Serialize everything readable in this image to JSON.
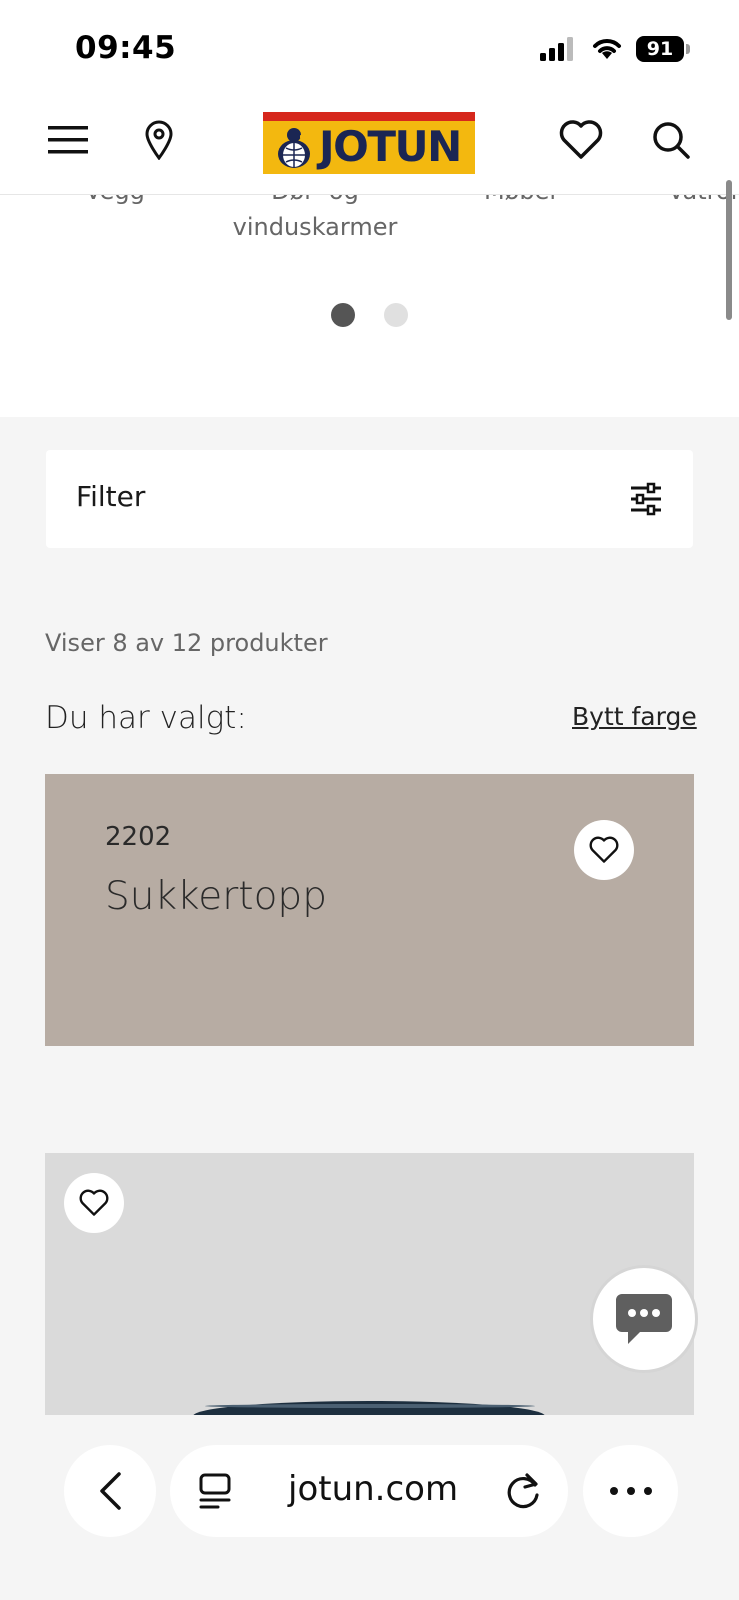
{
  "status_bar": {
    "time": "09:45",
    "battery": "91"
  },
  "header": {
    "logo_text": "JOTUN",
    "icons": [
      "menu-icon",
      "location-pin-icon",
      "heart-icon",
      "search-icon"
    ],
    "colors": {
      "logo_yellow": "#f3b80f",
      "logo_red": "#d6271c",
      "logo_navy": "#1b2653"
    }
  },
  "categories": {
    "items": [
      {
        "label": "Vegg"
      },
      {
        "label": "Dør- og vinduskarmer"
      },
      {
        "label": "Møbel"
      },
      {
        "label": "Våtrom"
      }
    ],
    "pagination": {
      "pages": 2,
      "active": 1
    }
  },
  "filter": {
    "label": "Filter",
    "icon": "sliders-icon"
  },
  "results": {
    "count_text": "Viser 8 av 12 produkter"
  },
  "selection": {
    "label": "Du har valgt:",
    "change_link": "Bytt farge"
  },
  "color_card": {
    "code": "2202",
    "name": "Sukkertopp",
    "swatch": "#b7aca3"
  },
  "product_card": {
    "icon": "heart-icon",
    "background": "#dadada"
  },
  "chat": {
    "icon": "chat-bubble-icon"
  },
  "browser": {
    "url": "jotun.com",
    "icons": [
      "back-arrow-icon",
      "tabs-icon",
      "reload-icon",
      "more-icon"
    ]
  }
}
